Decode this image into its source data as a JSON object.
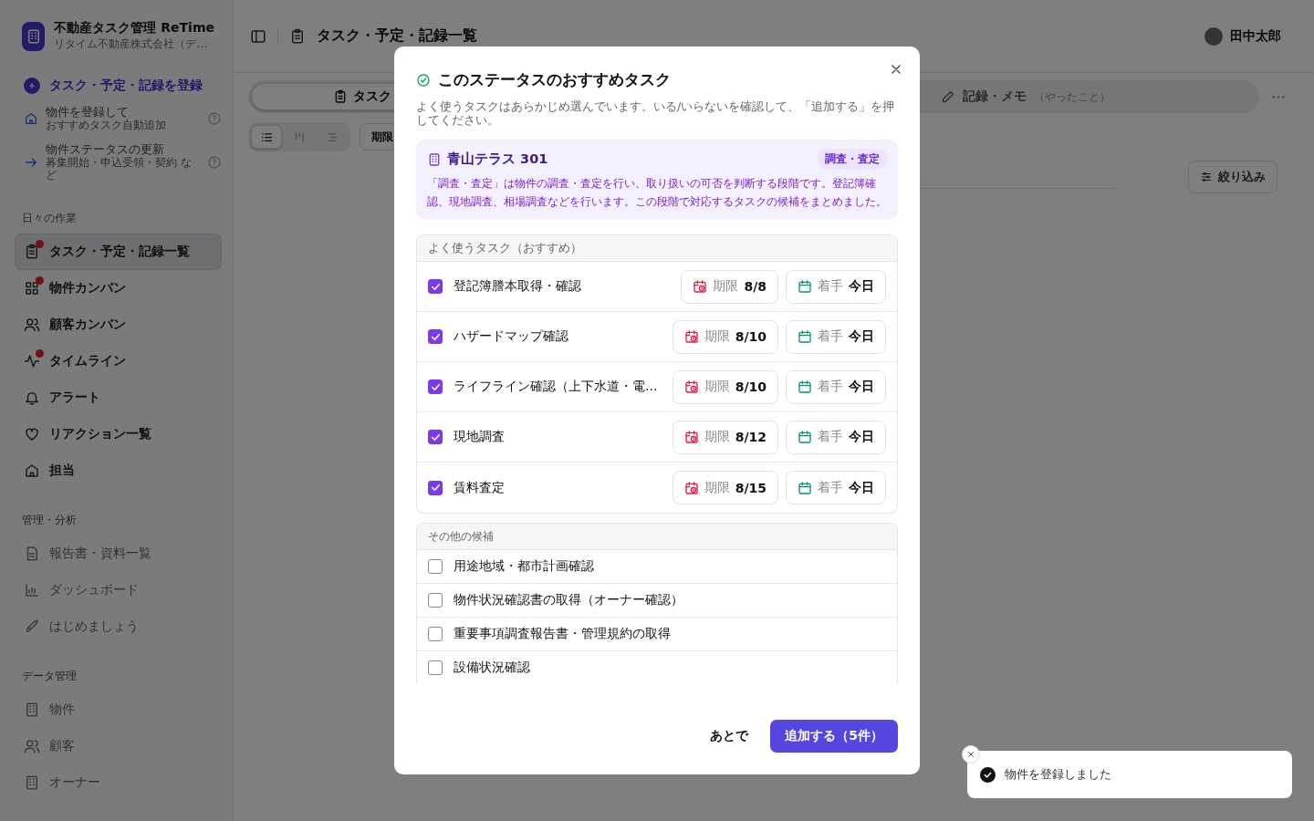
{
  "sidebar": {
    "brand": {
      "title": "不動産タスク管理 ReTime",
      "subtitle": "リタイム不動産株式会社（デ…"
    },
    "action": "タスク・予定・記録を登録",
    "helpers": [
      {
        "title": "物件を登録して",
        "sub": "おすすめタスク自動追加"
      },
      {
        "title": "物件ステータスの更新",
        "sub": "募集開始・申込受領・契約 など"
      }
    ],
    "sections": [
      {
        "label": "日々の作業",
        "kind": "primary",
        "items": [
          {
            "label": "タスク・予定・記録一覧",
            "selected": true,
            "badge": true
          },
          {
            "label": "物件カンバン",
            "selected": false,
            "badge": true
          },
          {
            "label": "顧客カンバン",
            "selected": false,
            "badge": false
          },
          {
            "label": "タイムライン",
            "selected": false,
            "badge": true
          },
          {
            "label": "アラート",
            "selected": false,
            "badge": false
          },
          {
            "label": "リアクション一覧",
            "selected": false,
            "badge": false
          },
          {
            "label": "担当",
            "selected": false,
            "badge": false
          }
        ]
      },
      {
        "label": "管理・分析",
        "kind": "secondary",
        "items": [
          {
            "label": "報告書・資料一覧",
            "selected": false,
            "badge": false
          },
          {
            "label": "ダッシュボード",
            "selected": false,
            "badge": false
          },
          {
            "label": "はじめましょう",
            "selected": false,
            "badge": false
          }
        ]
      },
      {
        "label": "データ管理",
        "kind": "secondary",
        "items": [
          {
            "label": "物件",
            "selected": false,
            "badge": false
          },
          {
            "label": "顧客",
            "selected": false,
            "badge": false
          },
          {
            "label": "オーナー",
            "selected": false,
            "badge": false
          }
        ]
      }
    ]
  },
  "header": {
    "title": "タスク・予定・記録一覧",
    "user": "田中太郎"
  },
  "tabs": [
    {
      "label": "タスク",
      "selected": true
    },
    {
      "label": "記録・メモ",
      "note": "（やったこと）",
      "selected": false
    }
  ],
  "views": [
    {
      "selected": true
    },
    {
      "selected": false
    },
    {
      "selected": false
    }
  ],
  "sort_button": "期限",
  "filter_button": "絞り込み",
  "modal": {
    "title": "このステータスのおすすめタスク",
    "subtitle": "よく使うタスクはあらかじめ選んでいます。いる/いらないを確認して、「追加する」を押してください。",
    "property": {
      "name": "青山テラス 301",
      "status": "調査・査定",
      "description": "「調査・査定」は物件の調査・査定を行い、取り扱いの可否を判断する段階です。登記簿確認、現地調査、相場調査などを行います。この段階で対応するタスクの候補をまとめました。"
    },
    "groups": [
      {
        "label": "よく使うタスク（おすすめ）",
        "tasks": [
          {
            "name": "登記簿謄本取得・確認",
            "checked": true,
            "due_label": "期限",
            "due": "8/8",
            "start_label": "着手",
            "start": "今日"
          },
          {
            "name": "ハザードマップ確認",
            "checked": true,
            "due_label": "期限",
            "due": "8/10",
            "start_label": "着手",
            "start": "今日"
          },
          {
            "name": "ライフライン確認（上下水道・電…",
            "checked": true,
            "due_label": "期限",
            "due": "8/10",
            "start_label": "着手",
            "start": "今日"
          },
          {
            "name": "現地調査",
            "checked": true,
            "due_label": "期限",
            "due": "8/12",
            "start_label": "着手",
            "start": "今日"
          },
          {
            "name": "賃料査定",
            "checked": true,
            "due_label": "期限",
            "due": "8/15",
            "start_label": "着手",
            "start": "今日"
          }
        ]
      },
      {
        "label": "その他の候補",
        "tasks": [
          {
            "name": "用途地域・都市計画確認",
            "checked": false
          },
          {
            "name": "物件状況確認書の取得（オーナー確認）",
            "checked": false
          },
          {
            "name": "重要事項調査報告書・管理規約の取得",
            "checked": false
          },
          {
            "name": "設備状況確認",
            "checked": false
          }
        ]
      }
    ],
    "cancel": "あとで",
    "confirm": "追加する（5件）"
  },
  "toast": {
    "message": "物件を登録しました"
  }
}
